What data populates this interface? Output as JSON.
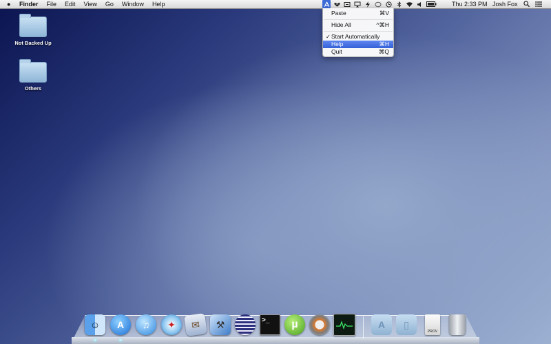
{
  "menubar": {
    "app_name": "Finder",
    "menus": [
      "File",
      "Edit",
      "View",
      "Go",
      "Window",
      "Help"
    ],
    "clock": "Thu 2:33 PM",
    "user": "Josh Fox"
  },
  "status_icons": [
    "app-store-icon",
    "dropbox-icon",
    "time-machine-icon",
    "airplay-icon",
    "flash-icon",
    "chat-icon",
    "clock-icon",
    "bluetooth-icon",
    "wifi-icon",
    "volume-icon",
    "battery-icon"
  ],
  "dropdown": {
    "items": [
      {
        "label": "Paste",
        "shortcut": "⌘V"
      },
      {
        "label": "Hide All",
        "shortcut": "^⌘H"
      },
      {
        "label": "Start Automatically",
        "shortcut": "",
        "checked": "✓"
      },
      {
        "label": "Help",
        "shortcut": "⌘H",
        "highlighted": true
      },
      {
        "label": "Quit",
        "shortcut": "⌘Q"
      }
    ]
  },
  "desktop": {
    "icons": [
      {
        "label": "Not Backed Up"
      },
      {
        "label": "Others"
      }
    ]
  },
  "dock": {
    "apps": [
      "finder-icon",
      "app-store-icon",
      "itunes-icon",
      "safari-icon",
      "mail-icon",
      "xcode-icon",
      "eclipse-icon",
      "terminal-icon",
      "utorrent-icon",
      "camtasia-icon",
      "activity-monitor-icon",
      "applications-folder-icon",
      "documents-folder-icon",
      "prov-file-icon",
      "trash-icon"
    ],
    "prov_label": "PROV"
  },
  "colors": {
    "highlight": "#3461d8",
    "active_tray": "#3c6ad7"
  }
}
